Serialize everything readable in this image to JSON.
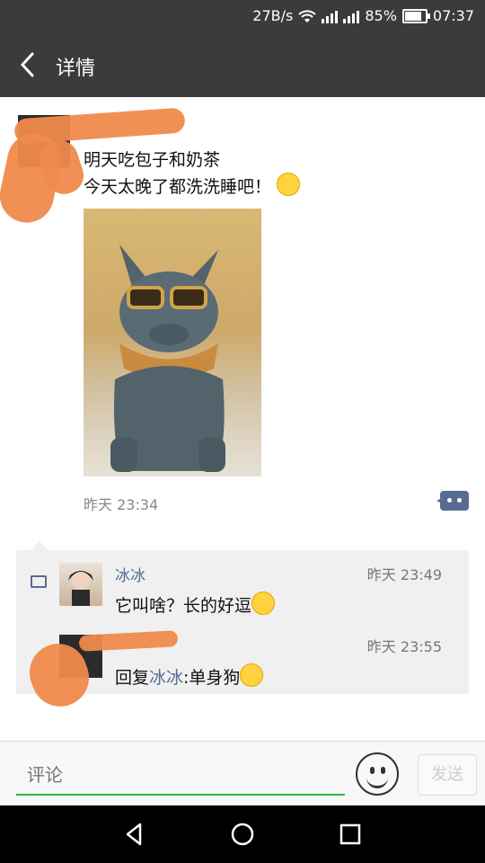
{
  "status_bar": {
    "speed": "27B/s",
    "battery": "85%",
    "time": "07:37"
  },
  "header": {
    "title": "详情"
  },
  "post": {
    "text_line1": "明天吃包子和奶茶",
    "text_line2": "今天太晚了都洗洗睡吧！",
    "time": "昨天 23:34"
  },
  "comments": [
    {
      "name": "冰冰",
      "time": "昨天 23:49",
      "text": "它叫啥？长的好逗"
    },
    {
      "reply_prefix": "回复",
      "reply_to": "冰冰",
      "reply_text": ":单身狗",
      "time": "昨天 23:55"
    }
  ],
  "input_bar": {
    "placeholder": "评论",
    "send_label": "发送"
  },
  "icons": [
    "back-icon",
    "wifi-icon",
    "signal-icon",
    "battery-icon",
    "comment-icon",
    "emoji-icon",
    "nav-back-icon",
    "nav-home-icon",
    "nav-recent-icon"
  ],
  "colors": {
    "link": "#576b95",
    "bar": "#3b3b3b",
    "accent": "#2fb44a"
  }
}
